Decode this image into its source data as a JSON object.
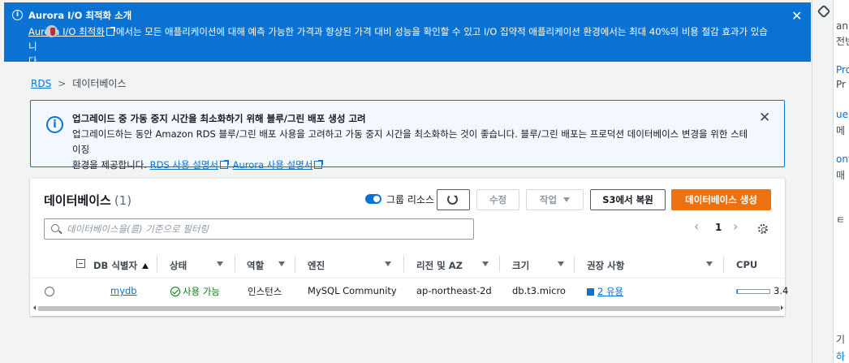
{
  "flash": {
    "title": "Aurora I/O 최적화 소개",
    "link_text": "Aurora I/O 최적화",
    "body_line1": "에서는 모든 애플리케이션에 대해 예측 가능한 가격과 향상된 가격 대비 성능을 확인할 수 있고 I/O 집약적 애플리케이션 환경에서는 최대 40%의 비용 절감 효과가 있습니",
    "body_line2": "다.",
    "close": "✕"
  },
  "breadcrumb": {
    "root": "RDS",
    "current": "데이터베이스"
  },
  "alert": {
    "title": "업그레이드 중 가동 중지 시간을 최소화하기 위해 블루/그린 배포 생성 고려",
    "body": "업그레이드하는 동안 Amazon RDS 블루/그린 배포 사용을 고려하고 가동 중지 시간을 최소화하는 것이 좋습니다. 블루/그린 배포는 프로덕션 데이터베이스 변경을 위한 스테이징",
    "body2": "환경을 제공합니다.",
    "link_rds": "RDS 사용 설명서",
    "link_aurora": "Aurora 사용 설명서",
    "close": "✕"
  },
  "panel": {
    "title": "데이터베이스",
    "count": "(1)",
    "toggle_label": "그룹 리소스",
    "modify": "수정",
    "actions": "작업",
    "restore": "S3에서 복원",
    "create": "데이터베이스 생성",
    "filter_placeholder": "데이터베이스을(를) 기준으로 필터링",
    "page": "1",
    "prev": "‹",
    "next": "›"
  },
  "columns": [
    "DB 식별자",
    "상태",
    "역할",
    "엔진",
    "리전 및 AZ",
    "크기",
    "권장 사항",
    "CPU"
  ],
  "rows": [
    {
      "id": "mydb",
      "status": "사용 가능",
      "role": "인스턴스",
      "engine": "MySQL Community",
      "region": "ap-northeast-2d",
      "size": "db.t3.micro",
      "recommend": "2 유용",
      "cpu": "3.4",
      "cpu_fraction": 0.034
    }
  ],
  "right_strip": [
    "an",
    "전번",
    "Pro",
    "Pr",
    "ue",
    "메",
    "ont",
    "매",
    "ㅌ D",
    "기",
    "하"
  ],
  "colors": {
    "brand_blue": "#0972d3",
    "primary_orange": "#ec7211",
    "success_green": "#037f0c"
  }
}
